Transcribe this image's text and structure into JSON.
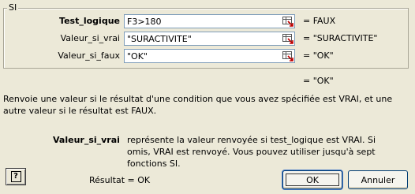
{
  "group_title": "SI",
  "args": [
    {
      "label": "Test_logique",
      "value": "F3>180",
      "result": "= FAUX",
      "bold": true
    },
    {
      "label": "Valeur_si_vrai",
      "value": "\"SURACTIVITE\"",
      "result": "= \"SURACTIVITE\"",
      "bold": false
    },
    {
      "label": "Valeur_si_faux",
      "value": "\"OK\"",
      "result": "= \"OK\"",
      "bold": false
    }
  ],
  "formula_result": "= \"OK\"",
  "description": "Renvoie une valeur si le résultat d'une condition que vous avez spécifiée est VRAI, et une autre valeur si le résultat est FAUX.",
  "current_arg": {
    "name": "Valeur_si_vrai",
    "description": "représente la valeur renvoyée si test_logique est VRAI. Si omis, VRAI est renvoyé. Vous pouvez utiliser jusqu'à sept fonctions SI."
  },
  "result_text": "Résultat = OK",
  "buttons": {
    "help": "?",
    "ok": "OK",
    "cancel": "Annuler"
  }
}
